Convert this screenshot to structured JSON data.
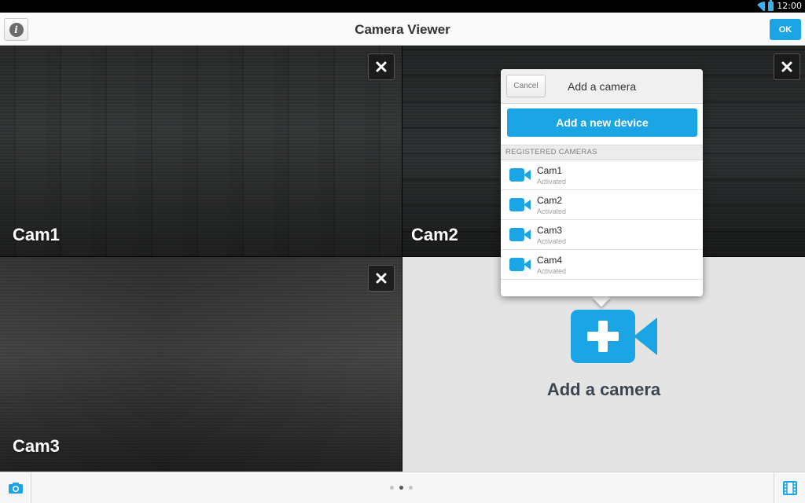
{
  "status_bar": {
    "time": "12:00"
  },
  "header": {
    "title": "Camera Viewer",
    "ok_label": "OK",
    "info_glyph": "i"
  },
  "tiles": [
    {
      "label": "Cam1"
    },
    {
      "label": "Cam2"
    },
    {
      "label": "Cam3"
    },
    {
      "label": "Add a camera"
    }
  ],
  "popup": {
    "title": "Add a camera",
    "cancel_label": "Cancel",
    "add_device_label": "Add a new device",
    "section_label": "REGISTERED CAMERAS",
    "cameras": [
      {
        "name": "Cam1",
        "status": "Activated"
      },
      {
        "name": "Cam2",
        "status": "Activated"
      },
      {
        "name": "Cam3",
        "status": "Activated"
      },
      {
        "name": "Cam4",
        "status": "Activated"
      }
    ]
  },
  "pager": {
    "pages": 3,
    "current": 2
  },
  "icons": {
    "info": "info-icon",
    "close": "close-icon",
    "video_camera": "video-camera-icon",
    "add_camera": "add-camera-icon",
    "snapshot": "camera-icon",
    "film": "film-icon",
    "wifi": "wifi-icon",
    "battery": "battery-icon"
  },
  "colors": {
    "accent": "#1ba5e4",
    "camera_icon": "#1ba5e4"
  }
}
